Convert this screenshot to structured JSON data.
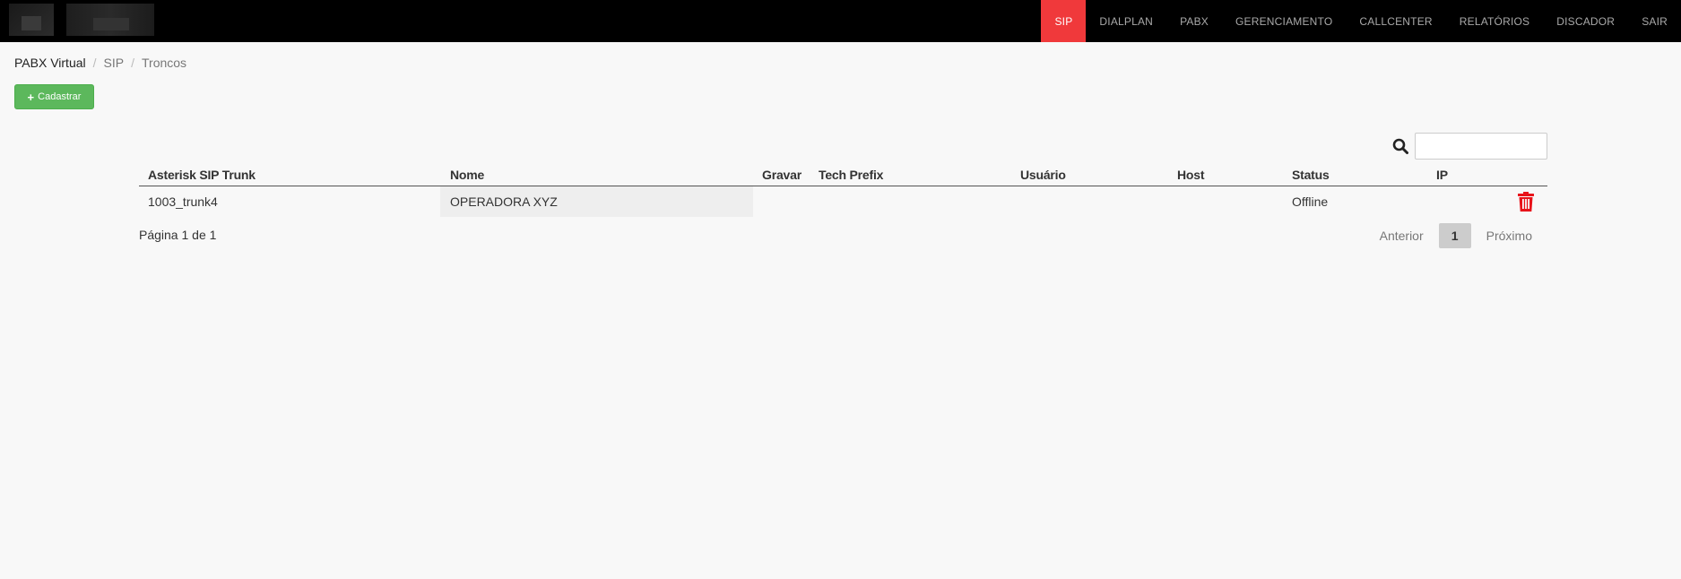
{
  "nav": {
    "items": [
      {
        "label": "SIP",
        "active": true
      },
      {
        "label": "DIALPLAN",
        "active": false
      },
      {
        "label": "PABX",
        "active": false
      },
      {
        "label": "GERENCIAMENTO",
        "active": false
      },
      {
        "label": "CALLCENTER",
        "active": false
      },
      {
        "label": "RELATÓRIOS",
        "active": false
      },
      {
        "label": "DISCADOR",
        "active": false
      },
      {
        "label": "SAIR",
        "active": false
      }
    ],
    "active_color": "#f0393b"
  },
  "breadcrumb": {
    "root": "PABX Virtual",
    "items": [
      "SIP",
      "Troncos"
    ]
  },
  "toolbar": {
    "add_label": "Cadastrar",
    "add_icon": "plus-icon",
    "add_color": "#5cb85c"
  },
  "search": {
    "icon": "search-icon",
    "value": "",
    "placeholder": ""
  },
  "table": {
    "headers": {
      "trunk": "Asterisk SIP Trunk",
      "nome": "Nome",
      "gravar": "Gravar",
      "prefix": "Tech Prefix",
      "usuario": "Usuário",
      "host": "Host",
      "status": "Status",
      "ip": "IP"
    },
    "rows": [
      {
        "trunk": "1003_trunk4",
        "nome": "OPERADORA XYZ",
        "gravar": "",
        "prefix": "",
        "usuario": "",
        "host": "",
        "status": "Offline",
        "ip": "",
        "action_icon": "trash-icon"
      }
    ],
    "delete_color": "#e8131a"
  },
  "pagination": {
    "info": "Página 1 de 1",
    "prev": "Anterior",
    "current": "1",
    "next": "Próximo"
  }
}
